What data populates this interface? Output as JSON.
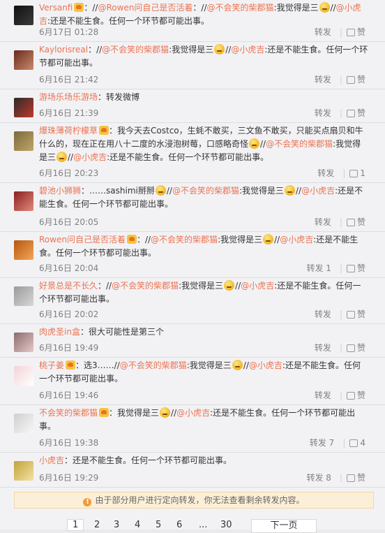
{
  "comments": [
    {
      "user": "Versanfi",
      "text": "：//@Rowen问自己是否活着：//@不会笑的柴郡猫:我觉得是三",
      "emoji_after": true,
      "rest": "//@小虎吉:还是不能生食。任何一个环节都可能出事。",
      "time": "6月17日 01:28",
      "forward": "转发",
      "like": "赞"
    },
    {
      "user": "Kaylorisreal",
      "text": "：//@不会笑的柴郡猫:我觉得是三",
      "emoji_after": true,
      "rest": "//@小虎吉:还是不能生食。任何一个环节都可能出事。",
      "time": "6月16日 21:42",
      "forward": "转发",
      "like": "赞"
    },
    {
      "user": "游场乐场乐游场",
      "text": "：转发微博",
      "time": "6月16日 21:39",
      "forward": "转发",
      "like": "赞"
    },
    {
      "user": "爆珠薄荷柠檬草",
      "text": "：我今天去Costco，生蚝不敢买，三文鱼不敢买，只能买点扇贝和牛什么的，现在正在用八十二度的水浸泡树莓，口感略奇怪",
      "emoji_after": true,
      "rest": "//@不会笑的柴郡猫:我觉得是三",
      "emoji_after2": true,
      "rest2": "//@小虎吉:还是不能生食。任何一个环节都可能出事。",
      "time": "6月16日 20:23",
      "forward": "转发",
      "like": "1"
    },
    {
      "user": "碧池小狮狮",
      "text": "：……sashimi掰掰",
      "emoji_after": true,
      "rest": "//@不会笑的柴郡猫:我觉得是三",
      "emoji_after2": true,
      "rest2": "//@小虎吉:还是不能生食。任何一个环节都可能出事。",
      "time": "6月16日 20:05",
      "forward": "转发",
      "like": "赞"
    },
    {
      "user": "Rowen问自己是否活着",
      "text": "：//@不会笑的柴郡猫:我觉得是三",
      "emoji_after": true,
      "rest": "//@小虎吉:还是不能生食。任何一个环节都可能出事。",
      "time": "6月16日 20:04",
      "forward": "转发 1",
      "like": "赞"
    },
    {
      "user": "好景总是不长久",
      "text": "：//@不会笑的柴郡猫:我觉得是三",
      "emoji_after": true,
      "rest": "//@小虎吉:还是不能生食。任何一个环节都可能出事。",
      "time": "6月16日 20:02",
      "forward": "转发",
      "like": "赞"
    },
    {
      "user": "肉虎圣in盒",
      "text": "：很大可能性是第三个",
      "time": "6月16日 19:49",
      "forward": "转发",
      "like": "赞"
    },
    {
      "user": "桃子姜",
      "text": "：选3……//@不会笑的柴郡猫:我觉得是三",
      "emoji_after": true,
      "rest": "//@小虎吉:还是不能生食。任何一个环节都可能出事。",
      "time": "6月16日 19:46",
      "forward": "转发",
      "like": "赞"
    },
    {
      "user": "不会笑的柴郡猫",
      "text": "：我觉得是三",
      "emoji_after": true,
      "rest": "//@小虎吉:还是不能生食。任何一个环节都可能出事。",
      "time": "6月16日 19:38",
      "forward": "转发 7",
      "like": "4"
    },
    {
      "user": "小虎吉",
      "text": "：还是不能生食。任何一个环节都可能出事。",
      "time": "6月16日 19:29",
      "forward": "转发 8",
      "like": "赞"
    }
  ],
  "notice": "由于部分用户进行定向转发，你无法查看剩余转发内容。",
  "pager": {
    "pages": [
      "1",
      "2",
      "3",
      "4",
      "5",
      "6",
      "...",
      "30"
    ],
    "next": "下一页"
  },
  "colors": {
    "link": "#eb7350",
    "meta": "#808080",
    "notice_bg": "#fcefd8"
  }
}
